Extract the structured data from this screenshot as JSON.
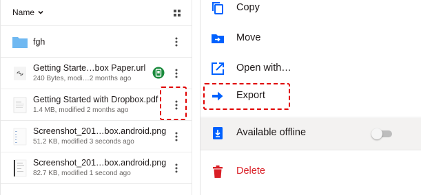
{
  "file_list": {
    "sort_label": "Name",
    "rows": [
      {
        "name": "fgh",
        "meta": "",
        "kind": "folder"
      },
      {
        "name": "Getting Starte…box Paper.url",
        "meta": "240 Bytes, modi…2 months ago",
        "kind": "link",
        "status": "available-offline-badge"
      },
      {
        "name": "Getting Started with Dropbox.pdf",
        "meta": "1.4 MB, modified 2 months ago",
        "kind": "pdf"
      },
      {
        "name": "Screenshot_201…box.android.png",
        "meta": "51.2 KB, modified 3 seconds ago",
        "kind": "image"
      },
      {
        "name": "Screenshot_201…box.android.png",
        "meta": "82.7 KB, modified 1 second ago",
        "kind": "image"
      }
    ]
  },
  "context_menu": {
    "items": {
      "copy": "Copy",
      "move": "Move",
      "open_with": "Open with…",
      "export": "Export",
      "available_offline": "Available offline",
      "delete": "Delete"
    },
    "available_offline_enabled": false
  },
  "colors": {
    "accent_blue": "#0061fe",
    "delete_red": "#d91f26",
    "highlight_red": "#e00000",
    "badge_green": "#1a8a3c",
    "folder_blue": "#6fb8f1"
  }
}
